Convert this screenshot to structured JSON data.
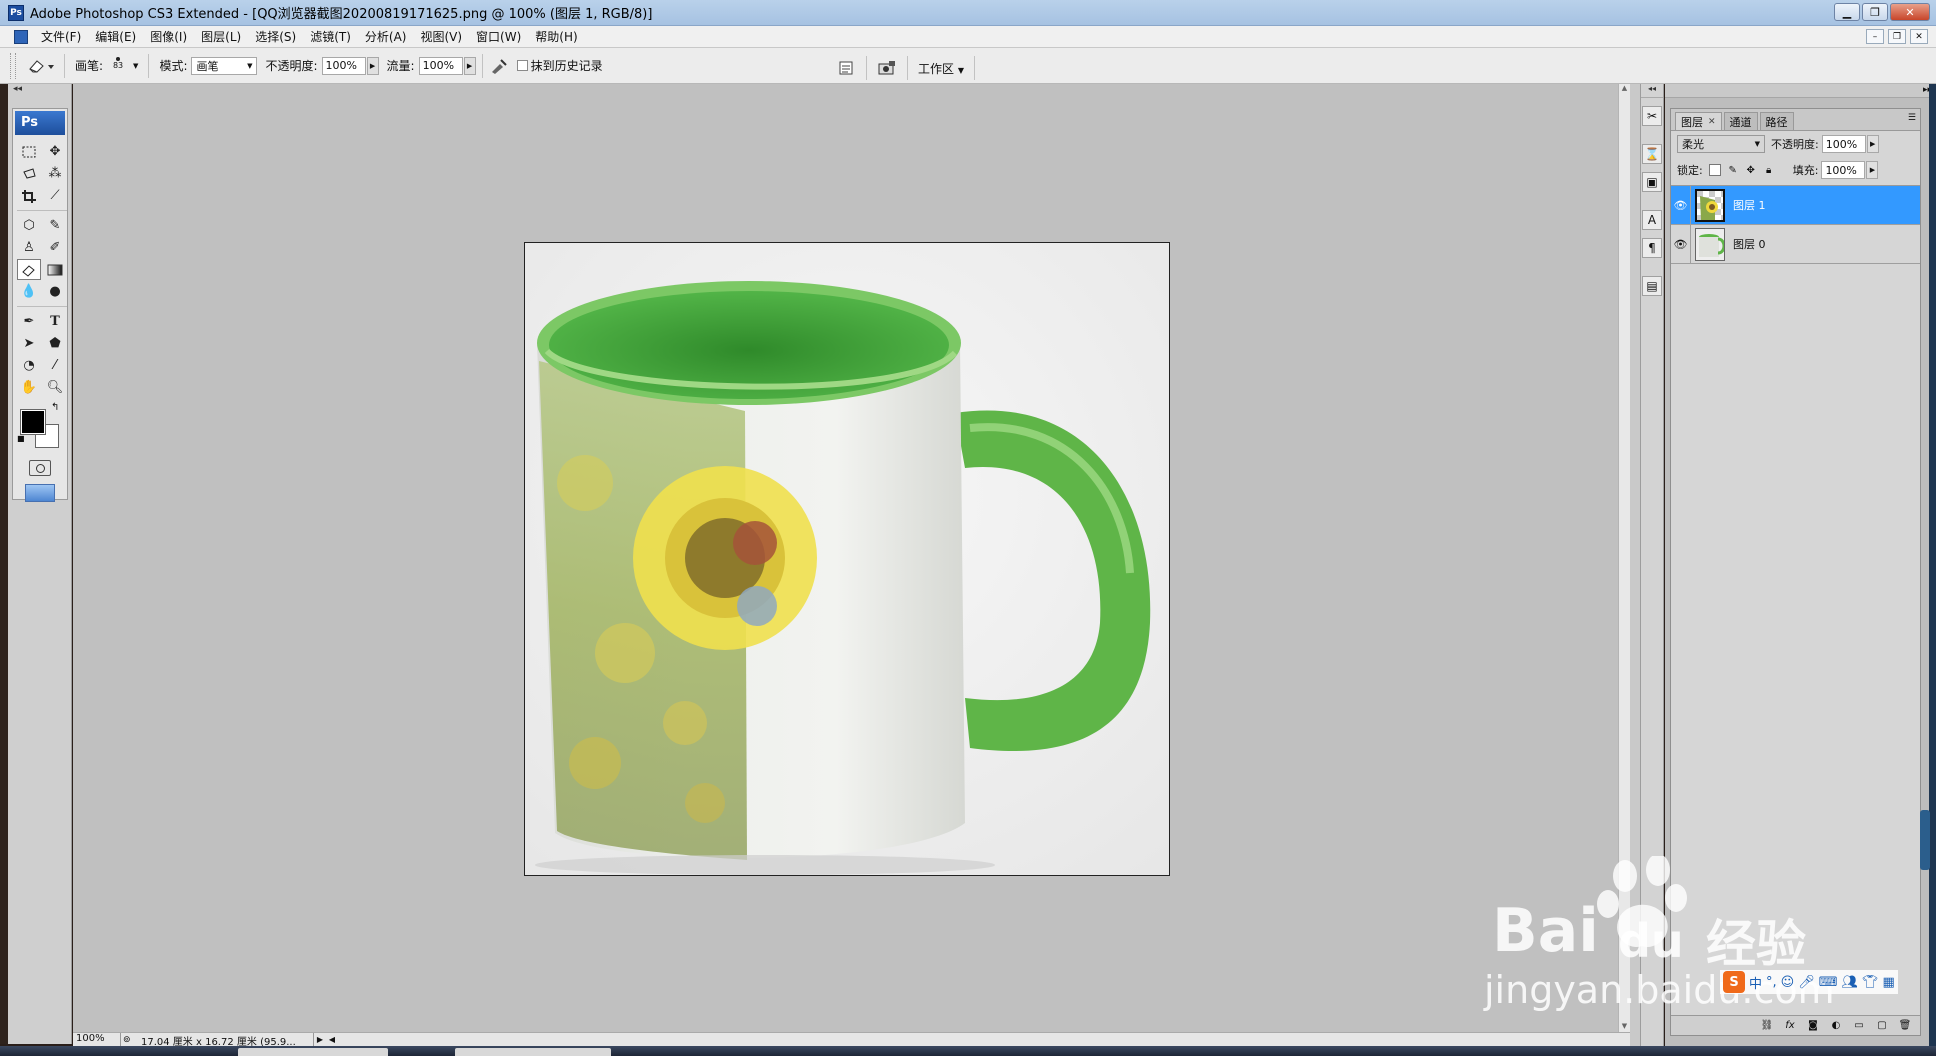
{
  "app": {
    "title": "Adobe Photoshop CS3 Extended - [QQ浏览器截图20200819171625.png @ 100% (图层 1, RGB/8)]",
    "logo": "Ps"
  },
  "window_buttons": [
    "minimize-icon",
    "restore-icon",
    "close-icon"
  ],
  "menu": [
    "文件(F)",
    "编辑(E)",
    "图像(I)",
    "图层(L)",
    "选择(S)",
    "滤镜(T)",
    "分析(A)",
    "视图(V)",
    "窗口(W)",
    "帮助(H)"
  ],
  "options": {
    "tool_icon": "eraser-icon",
    "brush_label": "画笔:",
    "brush_size": "83",
    "mode_label": "模式:",
    "mode_value": "画笔",
    "opacity_label": "不透明度:",
    "opacity_value": "100%",
    "flow_label": "流量:",
    "flow_value": "100%",
    "erase_history_label": "抹到历史记录",
    "erase_history_checked": false,
    "workspace_label": "工作区"
  },
  "toolbox": {
    "badge": "Ps",
    "active_tool": "eraser-tool",
    "foreground_color": "#000000",
    "background_color": "#ffffff"
  },
  "canvas": {
    "background": "#c0c0c0",
    "image_description_icon": "mug-with-sunflower-image"
  },
  "status": {
    "zoom": "100%",
    "doc_info": "17.04 厘米 x 16.72 厘米 (95.9..."
  },
  "layers_panel": {
    "tabs": [
      "图层",
      "通道",
      "路径"
    ],
    "active_tab": "图层",
    "blend_mode": "柔光",
    "opacity_label": "不透明度:",
    "opacity_value": "100%",
    "lock_label": "锁定:",
    "fill_label": "填充:",
    "fill_value": "100%",
    "layers": [
      {
        "name": "图层 1",
        "selected": true,
        "visible": true
      },
      {
        "name": "图层 0",
        "selected": false,
        "visible": true
      }
    ],
    "footer_icons": [
      "link-icon",
      "fx-icon",
      "mask-icon",
      "adjustment-icon",
      "group-icon",
      "new-layer-icon",
      "trash-icon"
    ]
  },
  "watermark": {
    "brand": "Bai",
    "brand2": "du",
    "cn": "经验",
    "url": "jingyan.baidu.com"
  },
  "ime": {
    "logo": "S",
    "label": "中"
  }
}
